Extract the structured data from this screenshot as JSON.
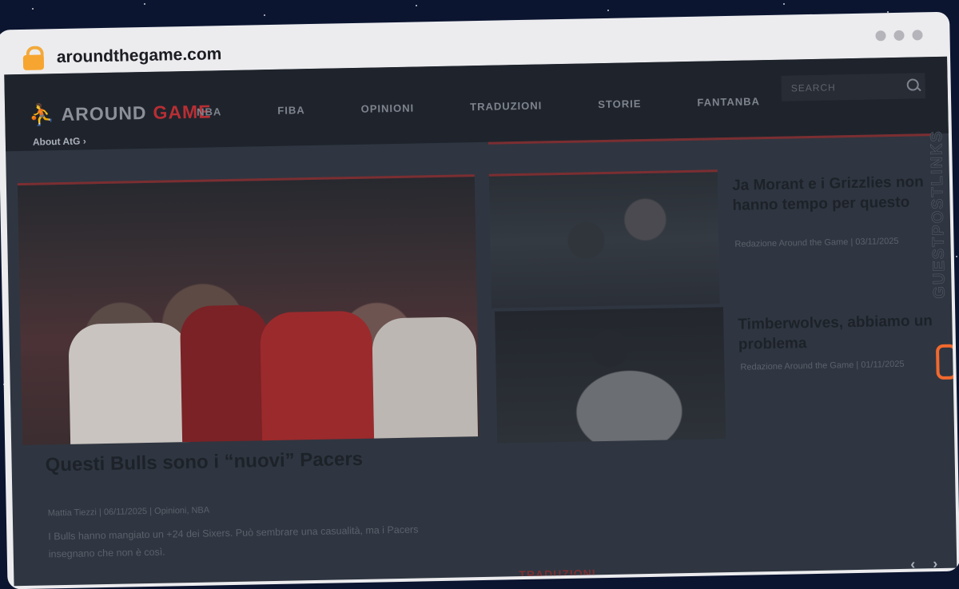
{
  "browser": {
    "url": "aroundthegame.com"
  },
  "site": {
    "logo": {
      "prefix": "AROUND",
      "suffix": "GAME"
    },
    "about_link": "About AtG ›",
    "nav": [
      "NBA",
      "FIBA",
      "OPINIONI",
      "TRADUZIONI",
      "STORIE",
      "FANTANBA"
    ],
    "search_placeholder": "SEARCH"
  },
  "hero": {
    "title": "Questi Bulls sono i “nuovi” Pacers",
    "meta": "Mattia Tiezzi | 06/11/2025 | Opinioni, NBA",
    "excerpt": "I Bulls hanno mangiato un +24 dei Sixers. Può sembrare una casualità, ma i Pacers insegnano che non è così."
  },
  "side_articles": [
    {
      "title": "Ja Morant e i Grizzlies non hanno tempo per questo",
      "meta": "Redazione Around the Game | 03/11/2025"
    },
    {
      "title": "Timberwolves, abbiamo un problema",
      "meta": "Redazione Around the Game | 01/11/2025"
    }
  ],
  "section": {
    "label": "TRADUZIONI"
  },
  "watermark": {
    "text": "GUESTPOSTLINKS"
  },
  "colors": {
    "accent": "#b82e34",
    "badge": "#f2692e"
  }
}
